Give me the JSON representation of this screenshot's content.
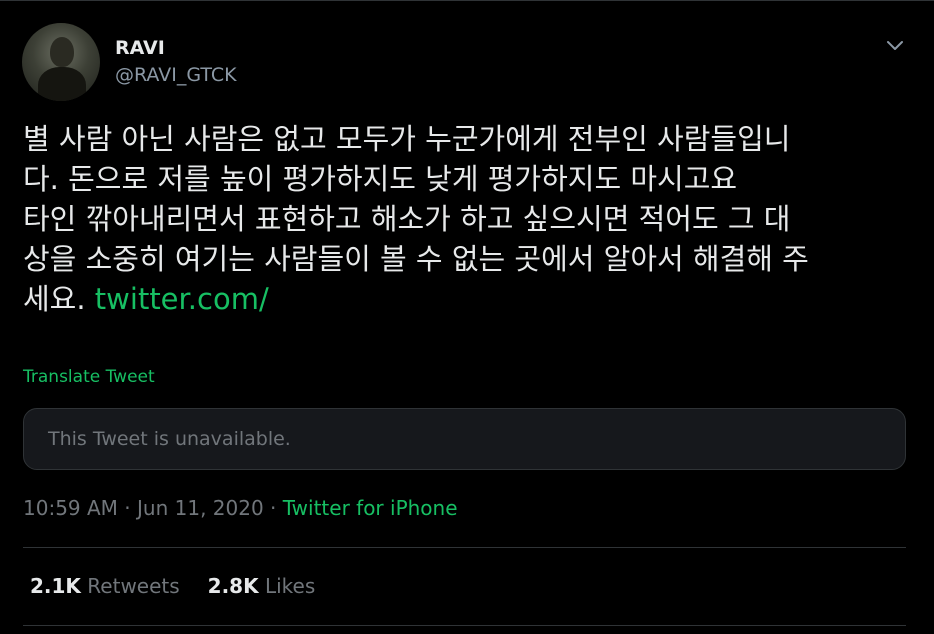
{
  "user": {
    "display_name": "RAVI",
    "handle": "@RAVI_GTCK"
  },
  "tweet": {
    "lines": [
      "별 사람 아닌 사람은 없고 모두가 누군가에게 전부인 사람들입니",
      "다. 돈으로 저를 높이 평가하지도 낮게 평가하지도 마시고요",
      "타인 깎아내리면서 표현하고 해소가 하고 싶으시면 적어도 그 대",
      "상을 소중히 여기는 사람들이 볼 수 없는 곳에서 알아서 해결해 주",
      "세요. "
    ],
    "link": "twitter.com/",
    "translate_label": "Translate Tweet"
  },
  "quote": {
    "text": "This Tweet is unavailable."
  },
  "meta": {
    "time": "10:59 AM",
    "sep1": " · ",
    "date": "Jun 11, 2020",
    "sep2": " · ",
    "source": "Twitter for iPhone"
  },
  "stats": {
    "retweets_count": "2.1K",
    "retweets_label": "Retweets",
    "likes_count": "2.8K",
    "likes_label": "Likes"
  },
  "icons": {
    "more": "chevron-down-icon"
  },
  "colors": {
    "background": "#000000",
    "accent": "#17bf63",
    "muted": "#71767b"
  }
}
